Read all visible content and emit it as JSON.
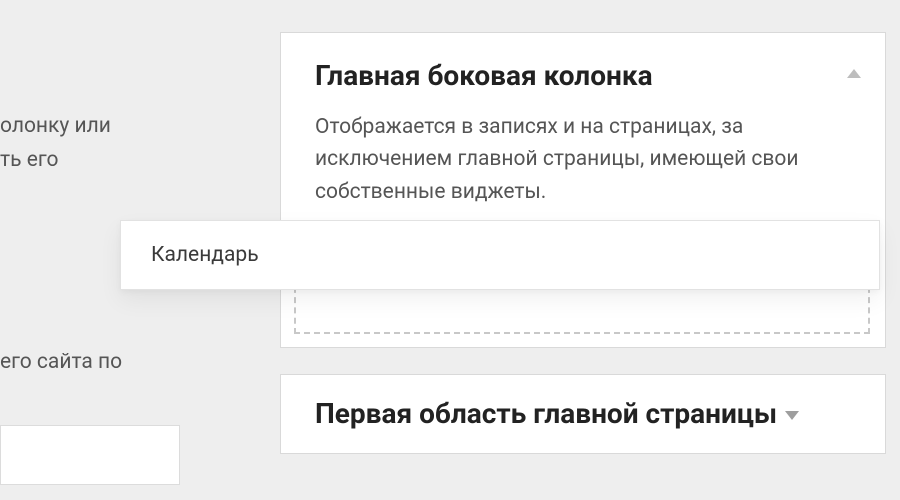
{
  "left": {
    "fragment1_line1": "олонку или",
    "fragment1_line2": "ть его",
    "fragment2": "его сайта по"
  },
  "drag": {
    "widget_name": "Календарь"
  },
  "areas": {
    "main_sidebar": {
      "title": "Главная боковая колонка",
      "description": "Отображается в записях и на страницах, за исключением главной страницы, имеющей свои собственные виджеты."
    },
    "front_page_first": {
      "title": "Первая область главной страницы"
    }
  }
}
